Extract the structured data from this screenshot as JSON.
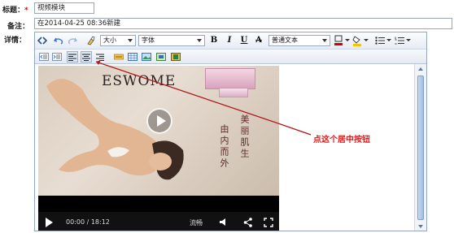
{
  "form": {
    "title_label": "标题：",
    "title_required": "*",
    "title_value": "视频模块",
    "remark_label": "备注：",
    "remark_value": "在2014-04-25 08:36新建",
    "detail_label": "详情："
  },
  "toolbar": {
    "font_size": "大小",
    "font_family": "字体",
    "bold": "B",
    "italic": "I",
    "underline": "U",
    "strike": "A",
    "format": "普通文本"
  },
  "video": {
    "brand": "ESWOME",
    "calligraphy_col1": "美丽肌生",
    "calligraphy_col2": "由内而外",
    "time": "00:00 / 18:12",
    "quality": "流畅"
  },
  "annotation": {
    "text": "点这个居中按钮",
    "color": "#e21b1b"
  },
  "colors": {
    "required": "#e00000",
    "text_color_bar": "#cc0000",
    "highlight_bar": "#f7c400"
  }
}
